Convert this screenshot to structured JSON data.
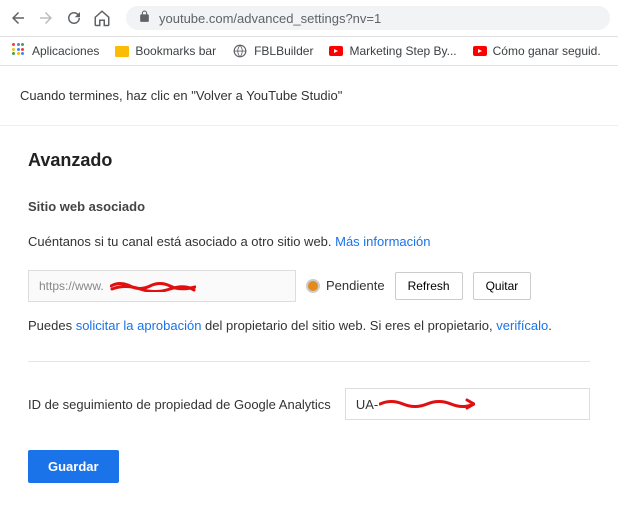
{
  "browser": {
    "url": "youtube.com/advanced_settings?nv=1"
  },
  "bookmarks": {
    "apps": "Aplicaciones",
    "items": [
      {
        "label": "Bookmarks bar"
      },
      {
        "label": "FBLBuilder"
      },
      {
        "label": "Marketing Step By..."
      },
      {
        "label": "Cómo ganar seguid."
      }
    ]
  },
  "notice": "Cuando termines, haz clic en \"Volver a YouTube Studio\"",
  "page": {
    "title": "Avanzado",
    "section1": {
      "title": "Sitio web asociado",
      "desc_prefix": "Cuéntanos si tu canal está asociado a otro sitio web. ",
      "desc_link": "Más información",
      "url_value": "https://www.",
      "status": "Pendiente",
      "refresh": "Refresh",
      "remove": "Quitar",
      "sub_prefix": "Puedes ",
      "sub_link1": "solicitar la aprobación",
      "sub_mid": " del propietario del sitio web. Si eres el propietario, ",
      "sub_link2": "verifícalo",
      "sub_suffix": "."
    },
    "section2": {
      "label": "ID de seguimiento de propiedad de Google Analytics",
      "value": "UA-"
    },
    "save": "Guardar"
  }
}
